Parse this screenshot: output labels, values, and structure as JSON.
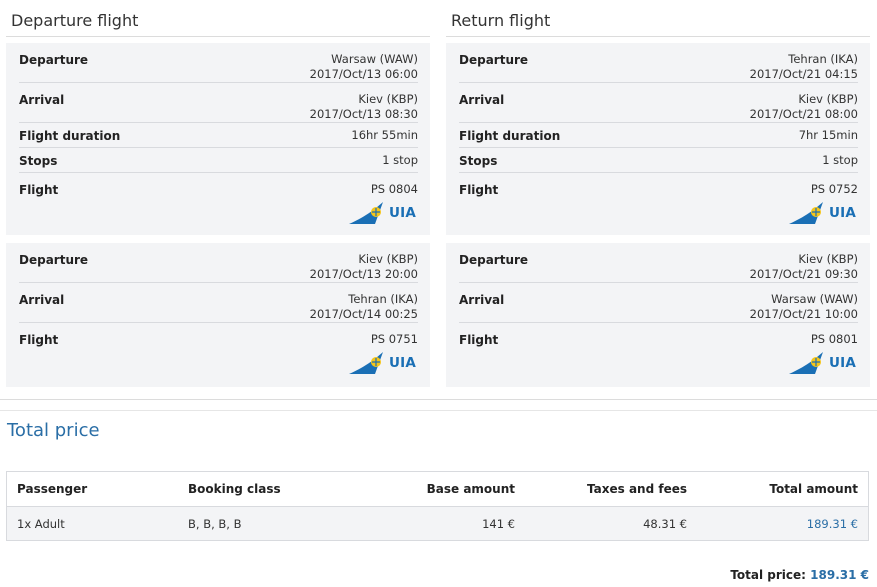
{
  "columns": [
    {
      "title": "Departure flight",
      "segments": [
        {
          "departure": {
            "label": "Departure",
            "place": "Warsaw (WAW)",
            "time": "2017/Oct/13 06:00"
          },
          "arrival": {
            "label": "Arrival",
            "place": "Kiev (KBP)",
            "time": "2017/Oct/13 08:30"
          },
          "duration": {
            "label": "Flight duration",
            "value": "16hr 55min"
          },
          "stops": {
            "label": "Stops",
            "value": "1 stop"
          },
          "flight": {
            "label": "Flight",
            "value": "PS 0804",
            "airline": "UIA"
          }
        },
        {
          "departure": {
            "label": "Departure",
            "place": "Kiev (KBP)",
            "time": "2017/Oct/13 20:00"
          },
          "arrival": {
            "label": "Arrival",
            "place": "Tehran (IKA)",
            "time": "2017/Oct/14 00:25"
          },
          "flight": {
            "label": "Flight",
            "value": "PS 0751",
            "airline": "UIA"
          }
        }
      ]
    },
    {
      "title": "Return flight",
      "segments": [
        {
          "departure": {
            "label": "Departure",
            "place": "Tehran (IKA)",
            "time": "2017/Oct/21 04:15"
          },
          "arrival": {
            "label": "Arrival",
            "place": "Kiev (KBP)",
            "time": "2017/Oct/21 08:00"
          },
          "duration": {
            "label": "Flight duration",
            "value": "7hr 15min"
          },
          "stops": {
            "label": "Stops",
            "value": "1 stop"
          },
          "flight": {
            "label": "Flight",
            "value": "PS 0752",
            "airline": "UIA"
          }
        },
        {
          "departure": {
            "label": "Departure",
            "place": "Kiev (KBP)",
            "time": "2017/Oct/21 09:30"
          },
          "arrival": {
            "label": "Arrival",
            "place": "Warsaw (WAW)",
            "time": "2017/Oct/21 10:00"
          },
          "flight": {
            "label": "Flight",
            "value": "PS 0801",
            "airline": "UIA"
          }
        }
      ]
    }
  ],
  "total_price_section": {
    "title": "Total price",
    "headers": [
      "Passenger",
      "Booking class",
      "Base amount",
      "Taxes and fees",
      "Total amount"
    ],
    "rows": [
      [
        "1x Adult",
        "B, B, B, B",
        "141 €",
        "48.31 €",
        "189.31 €"
      ]
    ],
    "grand_label": "Total price:",
    "grand_amount": "189.31 €"
  },
  "colors": {
    "accent": "#2a6ea6",
    "card_bg": "#f3f4f6",
    "uia_blue": "#1a6fb5",
    "uia_yellow": "#f5c518"
  },
  "icons": {
    "airline_logo": "uia-logo-icon"
  }
}
